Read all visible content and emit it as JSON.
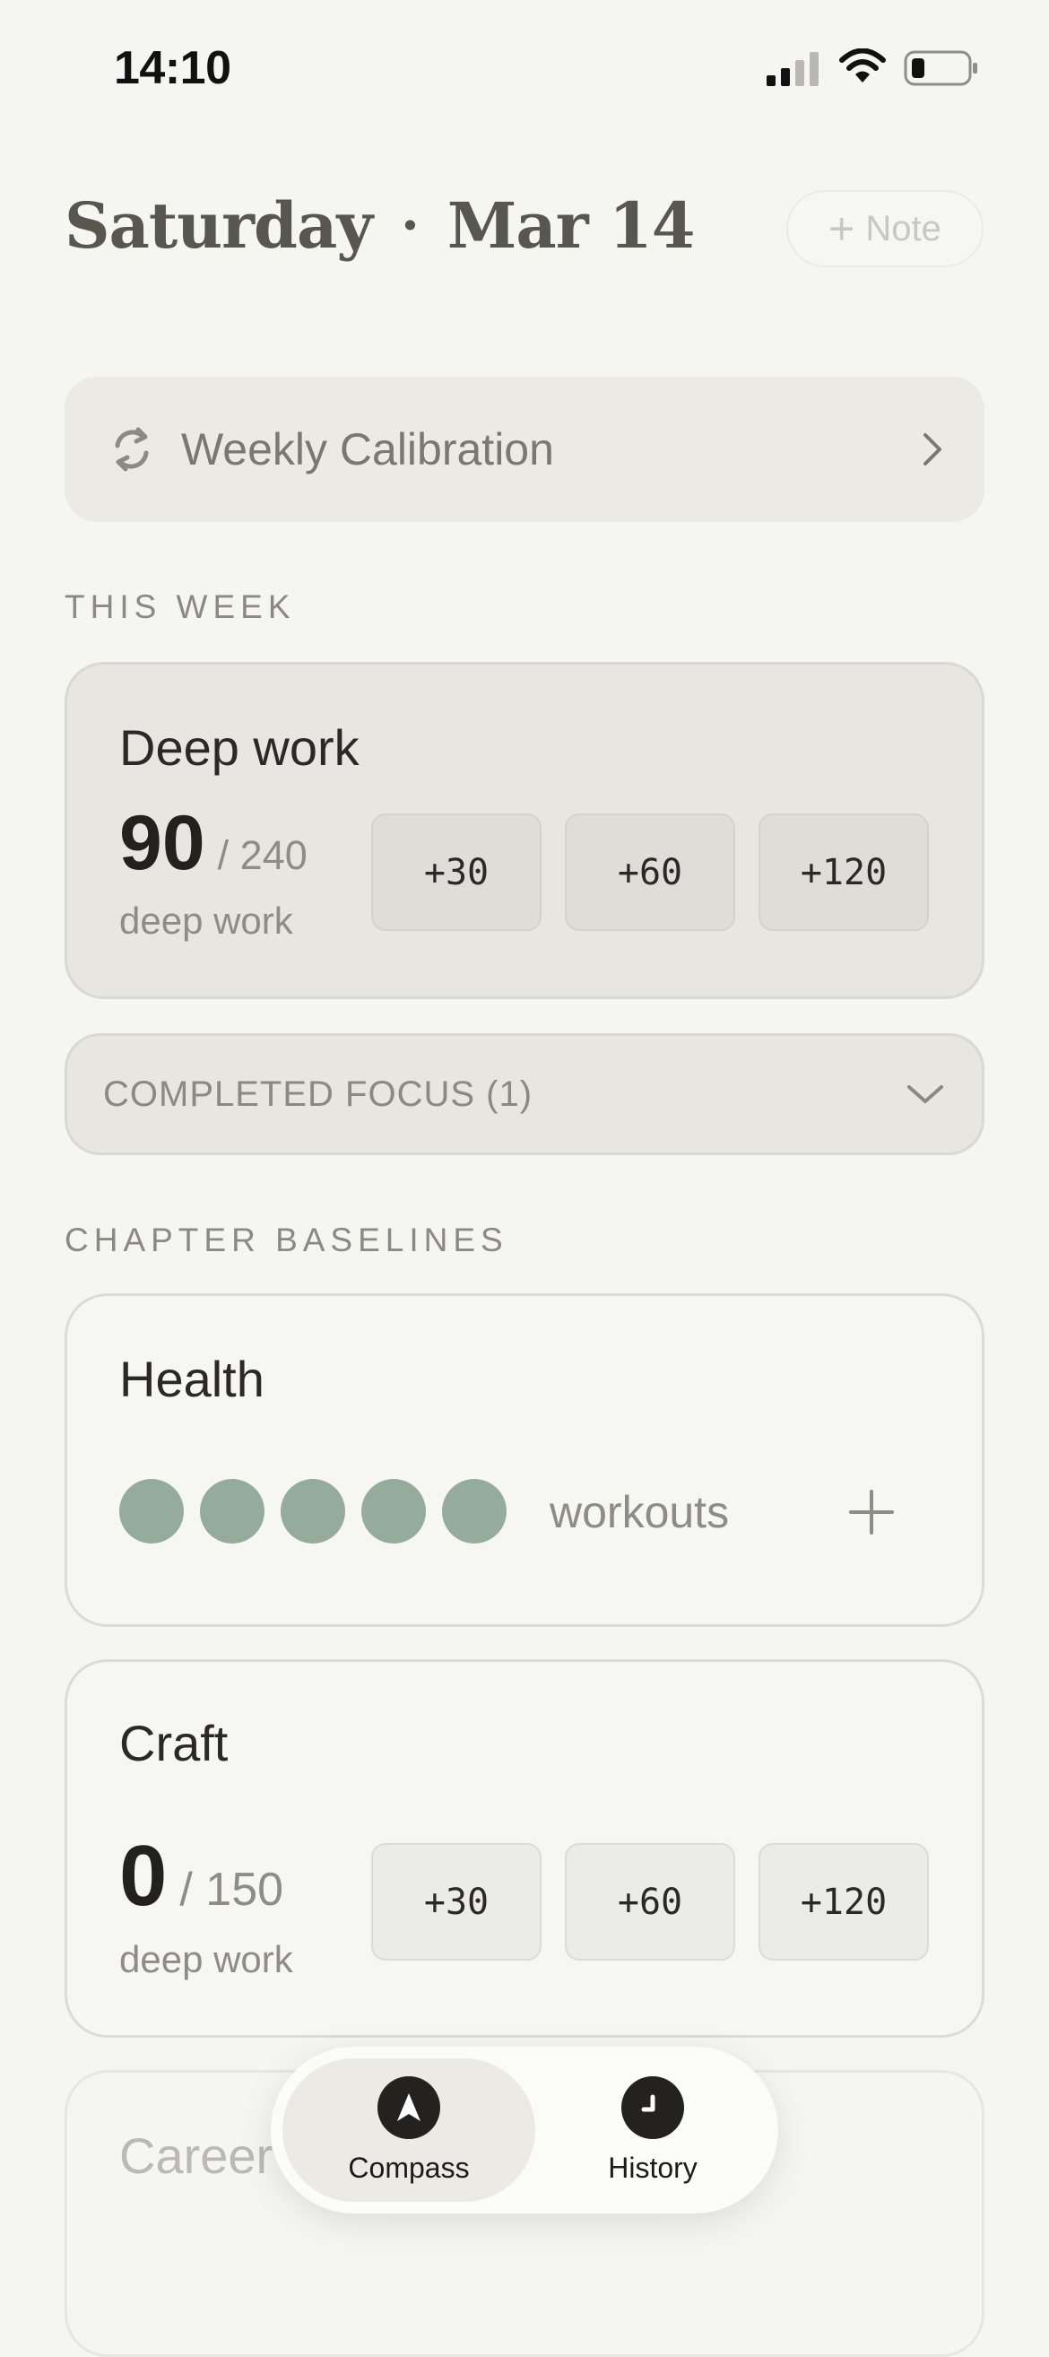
{
  "status_bar": {
    "time": "14:10"
  },
  "header": {
    "day": "Saturday",
    "separator": "·",
    "date": "Mar 14",
    "note_button": "Note"
  },
  "calibration": {
    "label": "Weekly Calibration"
  },
  "this_week": {
    "section_label": "THIS WEEK",
    "card": {
      "title": "Deep work",
      "value": "90",
      "goal": "/ 240",
      "unit": "deep work",
      "increments": [
        "+30",
        "+60",
        "+120"
      ]
    },
    "completed_focus": "COMPLETED FOCUS (1)"
  },
  "chapter_baselines": {
    "section_label": "CHAPTER BASELINES",
    "health": {
      "title": "Health",
      "unit": "workouts",
      "dots_filled": 5,
      "dots_total": 5
    },
    "craft": {
      "title": "Craft",
      "value": "0",
      "goal": "/ 150",
      "unit": "deep work",
      "increments": [
        "+30",
        "+60",
        "+120"
      ]
    },
    "career": {
      "title": "Career"
    }
  },
  "tabbar": {
    "tabs": [
      {
        "label": "Compass",
        "icon": "compass-icon",
        "active": true
      },
      {
        "label": "History",
        "icon": "clock-icon",
        "active": false
      }
    ]
  },
  "colors": {
    "accent_dot": "#95ac9c",
    "background": "#f5f5f2",
    "card": "#e8e6e1"
  }
}
